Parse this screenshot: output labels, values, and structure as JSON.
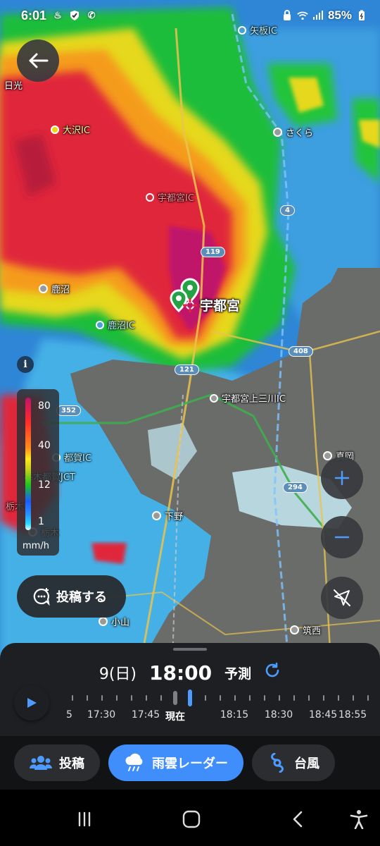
{
  "status_bar": {
    "time": "6:01",
    "battery": "85%"
  },
  "map": {
    "places": {
      "yaita_ic": "矢板IC",
      "nikko": "日光",
      "osawa_ic": "大沢IC",
      "sakura": "さくら",
      "utsunomiya_ic": "宇都宮IC",
      "kanuma": "鹿沼",
      "kanuma_ic": "鹿沼IC",
      "utsunomiya": "宇都宮",
      "kaminokawa_ic": "宇都宮上三川IC",
      "tsuga_ic": "都賀IC",
      "tochigi_tsuga_jct": "栃木都賀JCT",
      "tochigi_ic": "栃木IC",
      "tochigi": "栃木",
      "shimotsuke": "下野",
      "moka": "真岡",
      "oyama": "小山",
      "chikusei": "筑西"
    },
    "routes": {
      "r4": "4",
      "r119": "119",
      "r121": "121",
      "r408": "408",
      "r352": "352",
      "r294": "294"
    }
  },
  "legend": {
    "labels": [
      "80",
      "40",
      "12",
      "1"
    ],
    "unit": "mm/h",
    "colors": {
      "heavy": "#c0146a",
      "strong": "#ff2a2a",
      "moderate": "#ffe81a",
      "light": "#1ec41e",
      "weak": "#26d9ff"
    }
  },
  "post_button": {
    "label": "投稿する",
    "icon": "comment-add-icon"
  },
  "panel": {
    "date": "9(日)",
    "time": "18:00",
    "mode": "予測",
    "timeline_labels": [
      "5",
      "17:30",
      "17:45",
      "現在",
      "18:15",
      "18:30",
      "18:45",
      "18:55"
    ],
    "accent": "#4d9bff"
  },
  "tabs": [
    {
      "label": "投稿",
      "icon": "people-icon",
      "active": false
    },
    {
      "label": "雨雲レーダー",
      "icon": "rain-cloud-icon",
      "active": true
    },
    {
      "label": "台風",
      "icon": "typhoon-icon",
      "active": false
    }
  ]
}
